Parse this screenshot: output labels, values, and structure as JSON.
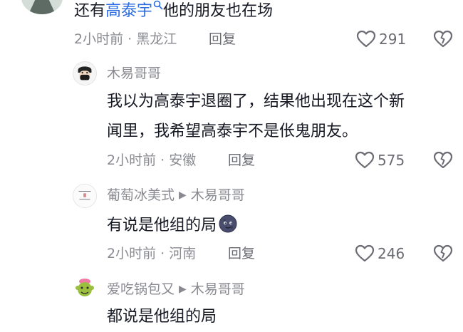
{
  "comments": [
    {
      "text_prefix": "还有",
      "text_link": "高泰宇",
      "text_suffix": "他的朋友也在场",
      "time": "2小时前",
      "location": "黑龙江",
      "reply_label": "回复",
      "likes": "291"
    },
    {
      "author": "木易哥哥",
      "text_line1": "我以为高泰宇退圈了，结果他出现在这个新",
      "text_line2": "闻里，我希望高泰宇不是伥鬼朋友。",
      "time": "2小时前",
      "location": "安徽",
      "reply_label": "回复",
      "likes": "575"
    },
    {
      "author": "葡萄冰美式",
      "reply_to": "木易哥哥",
      "text": "有说是他组的局",
      "time": "2小时前",
      "location": "河南",
      "reply_label": "回复",
      "likes": "246",
      "avatar_tag": "不追20个 不换头像"
    },
    {
      "author": "爱吃锅包又",
      "reply_to": "木易哥哥",
      "text": "都说是他组的局"
    }
  ],
  "separator": "·",
  "reply_arrow": "▶",
  "icons": {
    "like": "heart-outline-icon",
    "dislike": "broken-heart-icon",
    "search": "search-icon",
    "emoji": "dark-moon-face-emoji"
  },
  "colors": {
    "link": "#2b6de0",
    "meta": "#8a8b91",
    "text": "#161823"
  }
}
